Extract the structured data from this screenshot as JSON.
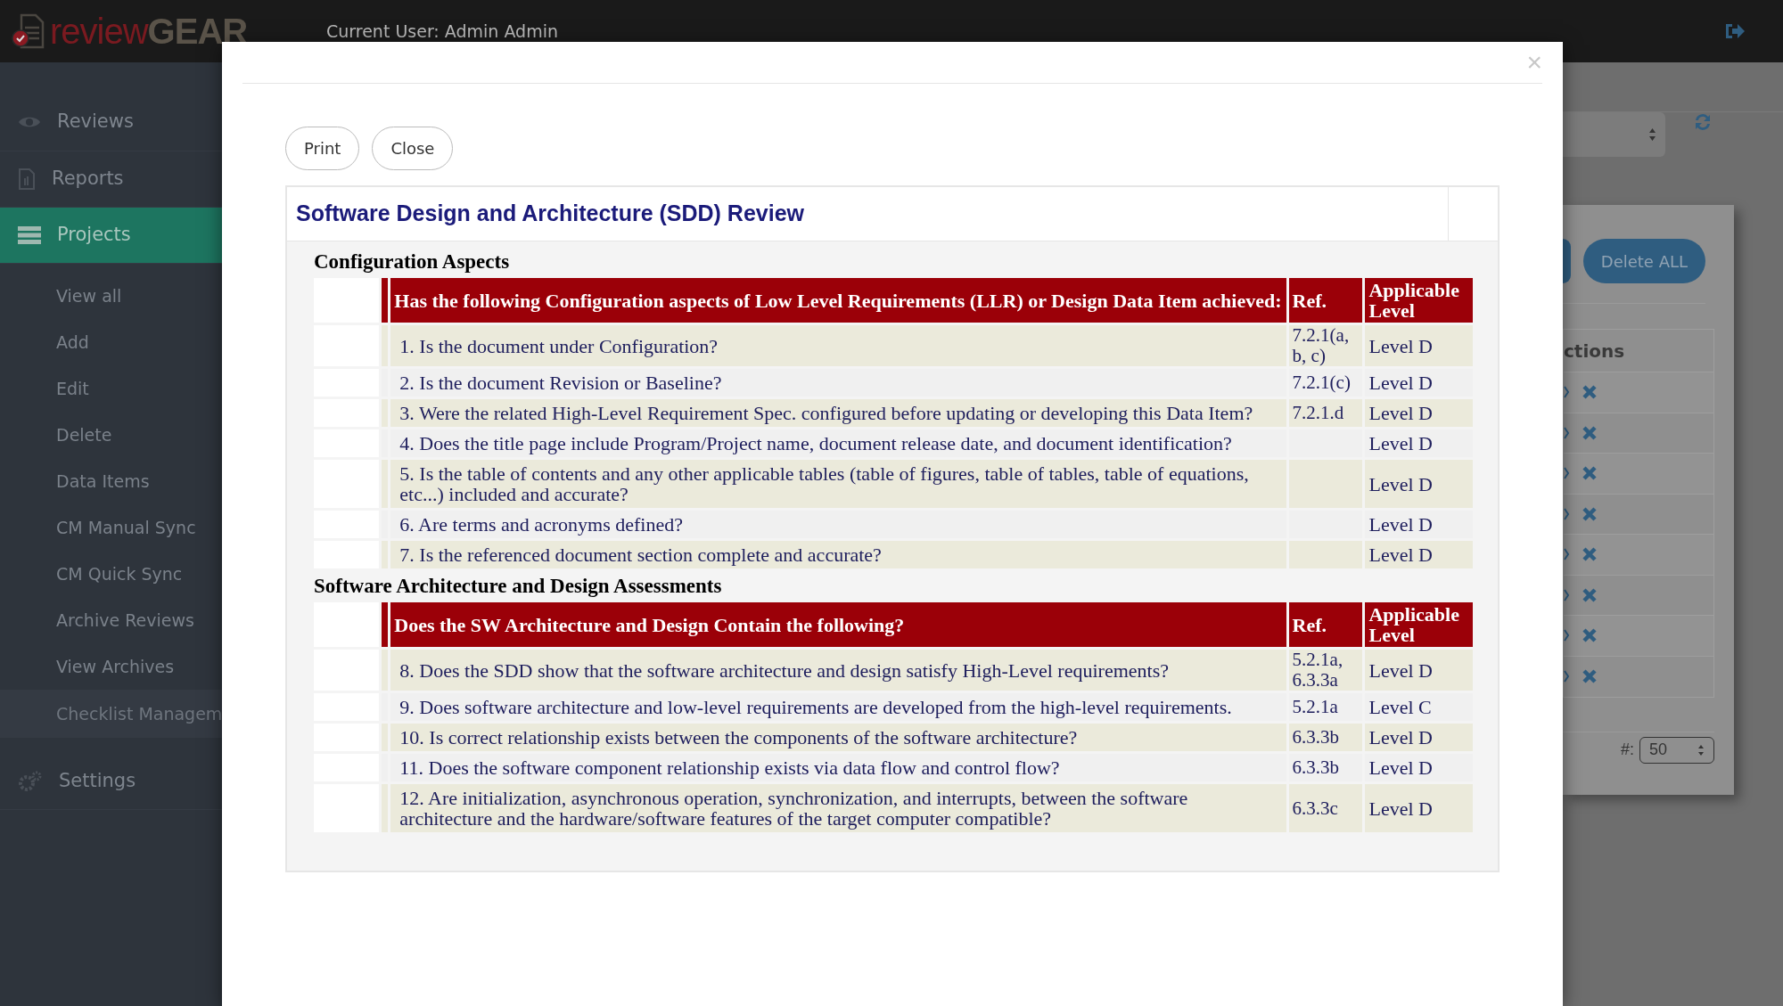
{
  "header": {
    "logo_first": "review",
    "logo_second": "GEAR",
    "current_user": "Current User: Admin Admin"
  },
  "sidebar": {
    "items": [
      {
        "label": "Reviews",
        "selected": false
      },
      {
        "label": "Reports",
        "selected": false
      },
      {
        "label": "Projects",
        "selected": true,
        "children": [
          {
            "label": "View all",
            "selected": false
          },
          {
            "label": "Add",
            "selected": false
          },
          {
            "label": "Edit",
            "selected": false
          },
          {
            "label": "Delete",
            "selected": false
          },
          {
            "label": "Data Items",
            "selected": false
          },
          {
            "label": "CM Manual Sync",
            "selected": false
          },
          {
            "label": "CM Quick Sync",
            "selected": false
          },
          {
            "label": "Archive Reviews",
            "selected": false
          },
          {
            "label": "View Archives",
            "selected": false
          },
          {
            "label": "Checklist Managem",
            "selected": true
          }
        ]
      },
      {
        "label": "Settings",
        "selected": false
      }
    ]
  },
  "background_page": {
    "delete_all_button": "Delete ALL",
    "actions_heading": "ctions",
    "action_rows": [
      {
        "kind": "actions"
      },
      {
        "kind": "actions"
      },
      {
        "kind": "actions"
      },
      {
        "kind": "actions"
      },
      {
        "kind": "actions"
      },
      {
        "kind": "actions"
      },
      {
        "kind": "actions"
      },
      {
        "kind": "actions"
      }
    ],
    "page_size": {
      "label": "#:",
      "value": "50"
    }
  },
  "modal": {
    "close": "×",
    "buttons": [
      "Print",
      "Close"
    ],
    "title": "Software Design and Architecture (SDD) Review",
    "sections": [
      {
        "heading": "Configuration Aspects",
        "columns": [
          "Has the following Configuration aspects of Low Level Requirements (LLR) or Design Data Item achieved:",
          "Ref.",
          "Applicable Level"
        ],
        "rows": [
          {
            "question": "1. Is the document under Configuration?",
            "ref": "7.2.1(a, b, c)",
            "level": "Level D"
          },
          {
            "question": "2. Is the document Revision or Baseline?",
            "ref": "7.2.1(c)",
            "level": "Level D"
          },
          {
            "question": "3. Were the related High-Level Requirement Spec. configured before updating or developing this Data Item?",
            "ref": "7.2.1.d",
            "level": "Level D"
          },
          {
            "question": "4. Does the title page include Program/Project name, document release date, and document identification?",
            "level": "Level D"
          },
          {
            "question": "5. Is the table of contents and any other applicable tables (table of figures, table of tables, table of equations, etc...) included and accurate?",
            "level": "Level D"
          },
          {
            "question": "6. Are terms and acronyms defined?",
            "level": "Level D"
          },
          {
            "question": "7. Is the referenced document section complete and accurate?",
            "level": "Level D"
          }
        ]
      },
      {
        "heading": "Software Architecture and Design Assessments",
        "columns": [
          "Does the SW Architecture and Design Contain the following?",
          "Ref.",
          "Applicable Level"
        ],
        "rows": [
          {
            "question": "8. Does the SDD show that the software architecture and design satisfy High-Level requirements?",
            "ref": "5.2.1a, 6.3.3a",
            "level": "Level D"
          },
          {
            "question": "9. Does software architecture and low-level requirements are developed from the high-level requirements.",
            "ref": "5.2.1a",
            "level": "Level C"
          },
          {
            "question": "10. Is correct relationship exists between the components of the software architecture?",
            "ref": "6.3.3b",
            "level": "Level D"
          },
          {
            "question": "11. Does the software component relationship exists via data flow and control flow?",
            "ref": "6.3.3b",
            "level": "Level D"
          },
          {
            "question": "12. Are initialization, asynchronous operation, synchronization, and interrupts, between the software architecture and the hardware/software features of the target computer compatible?",
            "ref": "6.3.3c",
            "level": "Level D"
          }
        ]
      }
    ]
  }
}
